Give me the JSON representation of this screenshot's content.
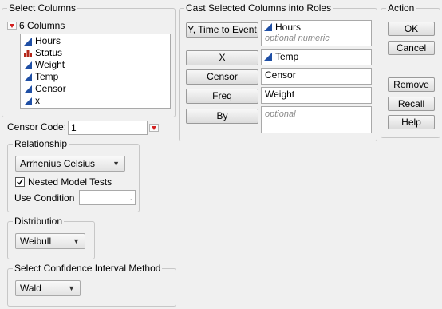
{
  "select_columns": {
    "title": "Select Columns",
    "count_label": "6 Columns",
    "columns": [
      {
        "name": "Hours",
        "icon": "continuous-icon"
      },
      {
        "name": "Status",
        "icon": "nominal-icon"
      },
      {
        "name": "Weight",
        "icon": "continuous-icon"
      },
      {
        "name": "Temp",
        "icon": "continuous-icon"
      },
      {
        "name": "Censor",
        "icon": "continuous-icon"
      },
      {
        "name": "x",
        "icon": "continuous-icon"
      }
    ]
  },
  "cast_roles": {
    "title": "Cast Selected Columns into Roles",
    "roles": [
      {
        "button": "Y, Time to Event",
        "value": "Hours",
        "placeholder": "optional numeric"
      },
      {
        "button": "X",
        "value": "Temp",
        "placeholder": ""
      },
      {
        "button": "Censor",
        "value": "Censor",
        "placeholder": ""
      },
      {
        "button": "Freq",
        "value": "Weight",
        "placeholder": ""
      },
      {
        "button": "By",
        "value": "",
        "placeholder": "optional"
      }
    ]
  },
  "action": {
    "title": "Action",
    "buttons": [
      "OK",
      "Cancel",
      "Remove",
      "Recall",
      "Help"
    ]
  },
  "censor_code": {
    "label": "Censor Code:",
    "value": "1"
  },
  "relationship": {
    "title": "Relationship",
    "selected": "Arrhenius Celsius",
    "nested_label": "Nested Model Tests",
    "nested_checked": true,
    "use_condition_label": "Use Condition",
    "use_condition_value": "."
  },
  "distribution": {
    "title": "Distribution",
    "selected": "Weibull"
  },
  "confidence": {
    "title": "Select Confidence Interval Method",
    "selected": "Wald"
  },
  "colors": {
    "red_triangle": "#d32020",
    "continuous_icon": "#1f4fa5",
    "nominal_icon": "#b5271a"
  }
}
